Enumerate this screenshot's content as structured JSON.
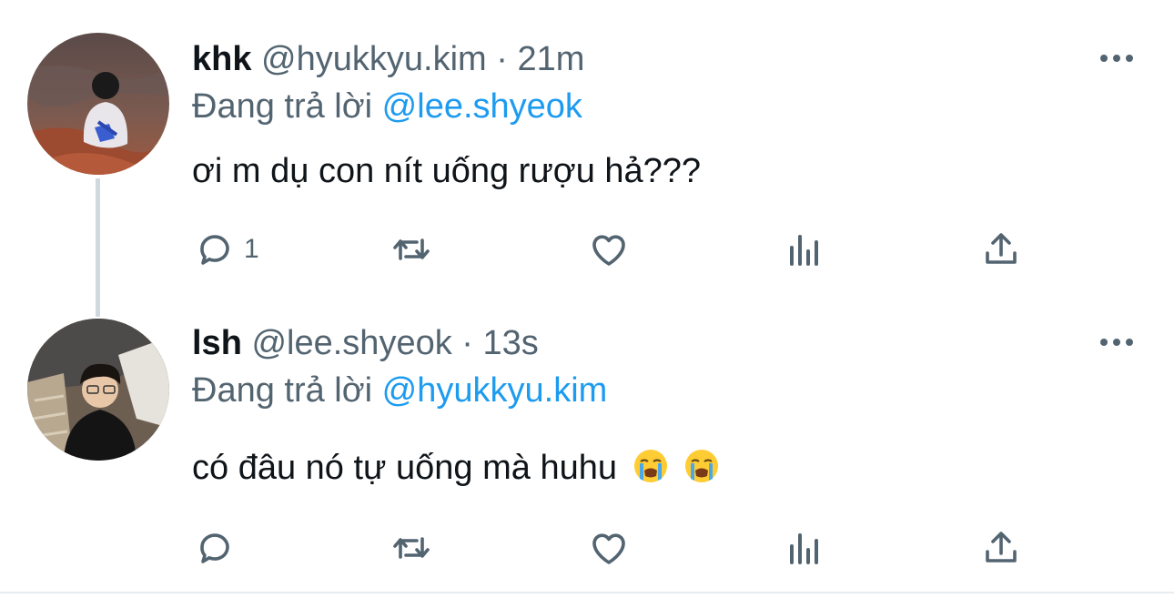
{
  "tweets": [
    {
      "name": "khk",
      "handle": "@hyukkyu.kim",
      "separator": "·",
      "time": "21m",
      "replying_prefix": "Đang trả lời",
      "replying_to": "@lee.shyeok",
      "text": "ơi m dụ con nít uống rượu hả???",
      "reply_count": "1",
      "icons": [
        "reply-icon",
        "retweet-icon",
        "like-icon",
        "views-icon",
        "share-icon",
        "more-icon"
      ]
    },
    {
      "name": "lsh",
      "handle": "@lee.shyeok",
      "separator": "·",
      "time": "13s",
      "replying_prefix": "Đang trả lời",
      "replying_to": "@hyukkyu.kim",
      "text": "có đâu nó tự uống mà huhu",
      "emojis": [
        "loudly-crying-face",
        "loudly-crying-face"
      ],
      "reply_count": "",
      "icons": [
        "reply-icon",
        "retweet-icon",
        "like-icon",
        "views-icon",
        "share-icon",
        "more-icon"
      ]
    }
  ],
  "colors": {
    "text": "#0f1419",
    "secondary": "#536471",
    "mention": "#1d9bf0",
    "thread_line": "#cfd9de"
  }
}
